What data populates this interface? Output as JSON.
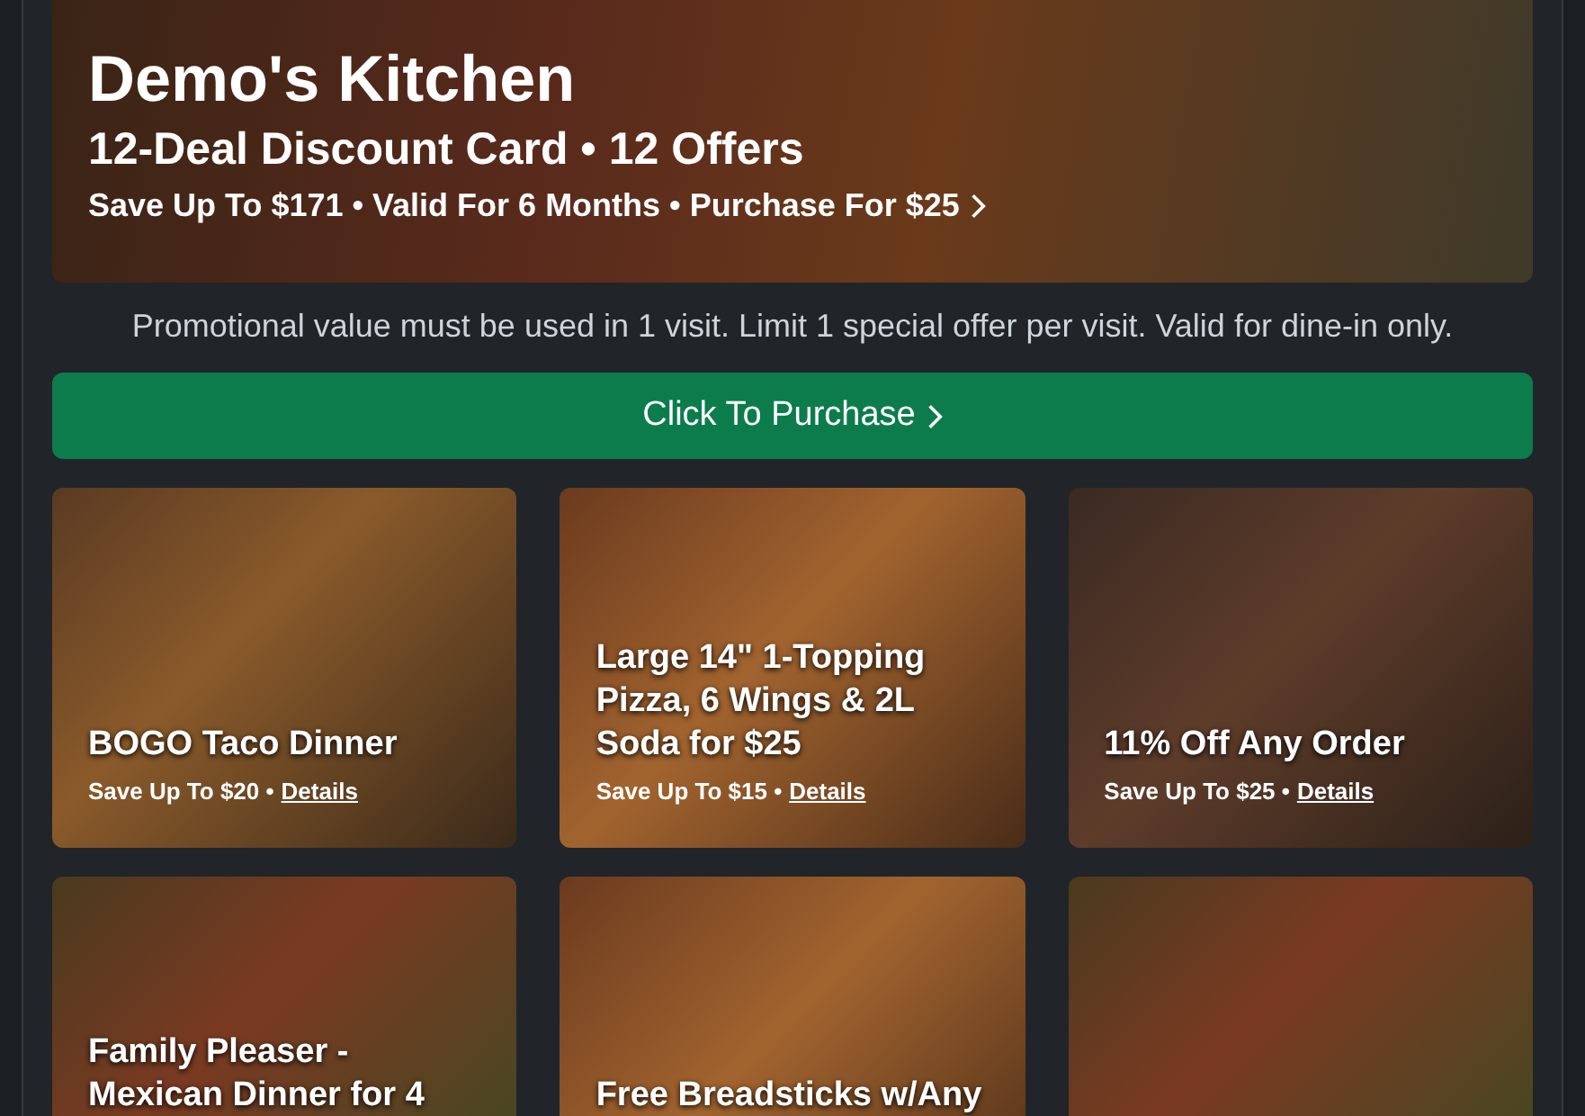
{
  "hero": {
    "title": "Demo's Kitchen",
    "subtitle": "12-Deal Discount Card • 12 Offers",
    "summary": "Save Up To $171 • Valid For 6 Months • Purchase For $25"
  },
  "terms": "Promotional value must be used in 1 visit. Limit 1 special offer per visit. Valid for dine-in only.",
  "purchase_button": "Click To Purchase",
  "offers": [
    {
      "kind": "taco",
      "title": "BOGO Taco Dinner",
      "savings": "Save Up To $20 •",
      "link": "Details"
    },
    {
      "kind": "pizza",
      "title": "Large 14\" 1-Topping Pizza, 6 Wings & 2L Soda for $25",
      "savings": "Save Up To $15 •",
      "link": "Details"
    },
    {
      "kind": "bowl",
      "title": "11% Off Any Order",
      "savings": "Save Up To $25 •",
      "link": "Details"
    },
    {
      "kind": "spread",
      "title": "Family Pleaser - Mexican Dinner for 4"
    },
    {
      "kind": "pizza",
      "title": "Free Breadsticks w/Any"
    },
    {
      "kind": "spread"
    }
  ]
}
